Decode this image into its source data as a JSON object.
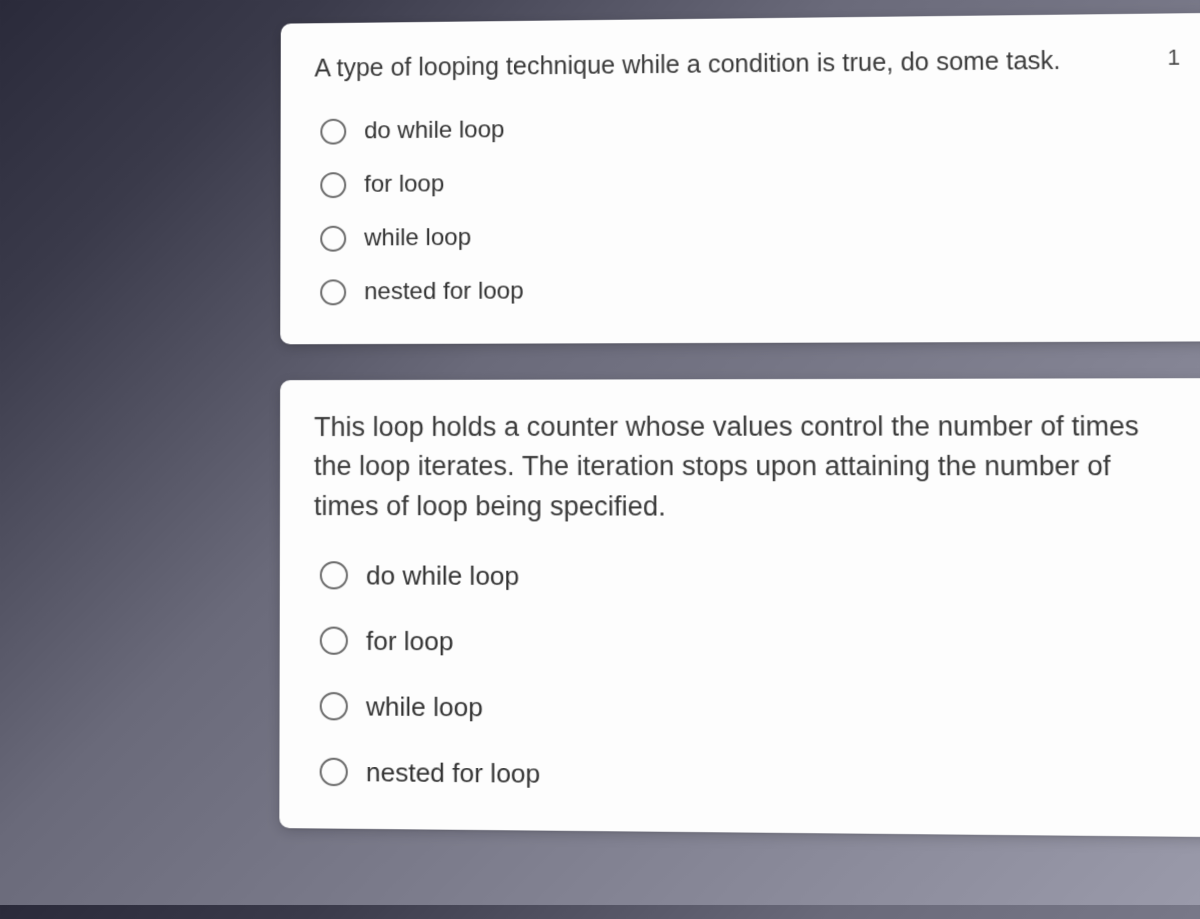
{
  "questions": [
    {
      "text": "A type of looping technique while a condition is true, do some task.",
      "points": "1",
      "options": [
        {
          "label": "do while loop"
        },
        {
          "label": "for loop"
        },
        {
          "label": "while loop"
        },
        {
          "label": "nested for loop"
        }
      ]
    },
    {
      "text": "This loop holds a counter whose values control the number of times the loop iterates. The iteration stops upon attaining the number of times of loop being specified.",
      "points": "",
      "options": [
        {
          "label": "do while loop"
        },
        {
          "label": "for loop"
        },
        {
          "label": "while loop"
        },
        {
          "label": "nested for loop"
        }
      ]
    }
  ]
}
